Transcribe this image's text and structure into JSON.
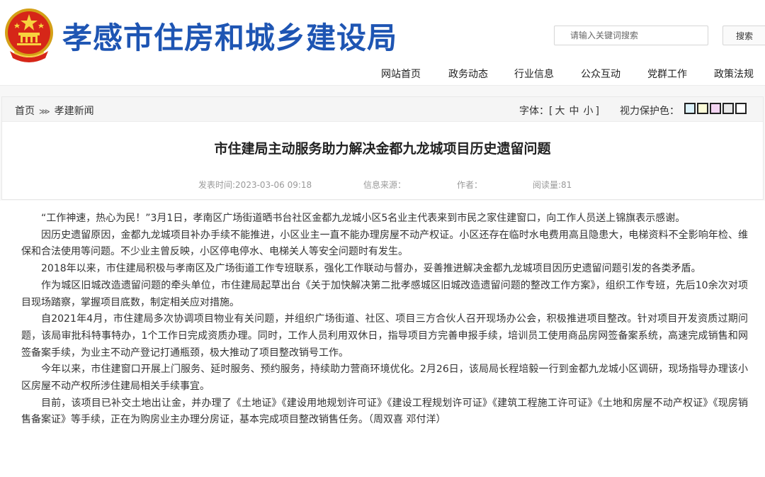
{
  "header": {
    "site_title": "孝感市住房和城乡建设局",
    "search_placeholder": "请输入关键词搜索",
    "search_button": "搜索"
  },
  "nav": {
    "items": [
      "网站首页",
      "政务动态",
      "行业信息",
      "公众互动",
      "党群工作",
      "政策法规"
    ]
  },
  "breadcrumb": {
    "home": "首页",
    "separator": "⋙",
    "current": "孝建新闻"
  },
  "font_size": {
    "label": "字体：[",
    "large": "大",
    "medium": "中",
    "small": "小",
    "end": "]"
  },
  "eye_care": {
    "label": "视力保护色：",
    "colors": [
      "#dcf2fb",
      "#fbfbd8",
      "#f3d5f2",
      "#e8e8e8",
      "#ffffff"
    ]
  },
  "article": {
    "title": "市住建局主动服务助力解决金都九龙城项目历史遗留问题",
    "publish_time": "发表时间:2023-03-06 09:18",
    "source": "信息来源：",
    "author": "作者：",
    "views": "阅读量:81",
    "paragraphs": [
      "“工作神速，热心为民！”3月1日，孝南区广场街道晒书台社区金都九龙城小区5名业主代表来到市民之家住建窗口，向工作人员送上锦旗表示感谢。",
      "因历史遗留原因，金都九龙城项目补办手续不能推进，小区业主一直不能办理房屋不动产权证。小区还存在临时水电费用高且隐患大，电梯资料不全影响年检、维保和合法使用等问题。不少业主曾反映，小区停电停水、电梯关人等安全问题时有发生。",
      "2018年以来，市住建局积极与孝南区及广场街道工作专班联系，强化工作联动与督办，妥善推进解决金都九龙城项目因历史遗留问题引发的各类矛盾。",
      "作为城区旧城改造遗留问题的牵头单位，市住建局起草出台《关于加快解决第二批孝感城区旧城改造遗留问题的整改工作方案》，组织工作专班，先后10余次对项目现场踏察，掌握项目底数，制定相关应对措施。",
      "自2021年4月，市住建局多次协调项目物业有关问题，并组织广场街道、社区、项目三方合伙人召开现场办公会，积极推进项目整改。针对项目开发资质过期问题，该局审批科特事特办，1个工作日完成资质办理。同时，工作人员利用双休日，指导项目方完善申报手续，培训员工使用商品房网签备案系统，高速完成销售和网签备案手续，为业主不动产登记打通瓶颈，极大推动了项目整改销号工作。",
      "今年以来，市住建窗口开展上门服务、延时服务、预约服务，持续助力营商环境优化。2月26日，该局局长程培毅一行到金都九龙城小区调研，现场指导办理该小区房屋不动产权所涉住建局相关手续事宜。",
      "目前，该项目已补交土地出让金，并办理了《土地证》《建设用地规划许可证》《建设工程规划许可证》《建筑工程施工许可证》《土地和房屋不动产权证》《现房销售备案证》等手续，正在为购房业主办理分房证，基本完成项目整改销售任务。（周双喜 邓付洋）"
    ]
  }
}
